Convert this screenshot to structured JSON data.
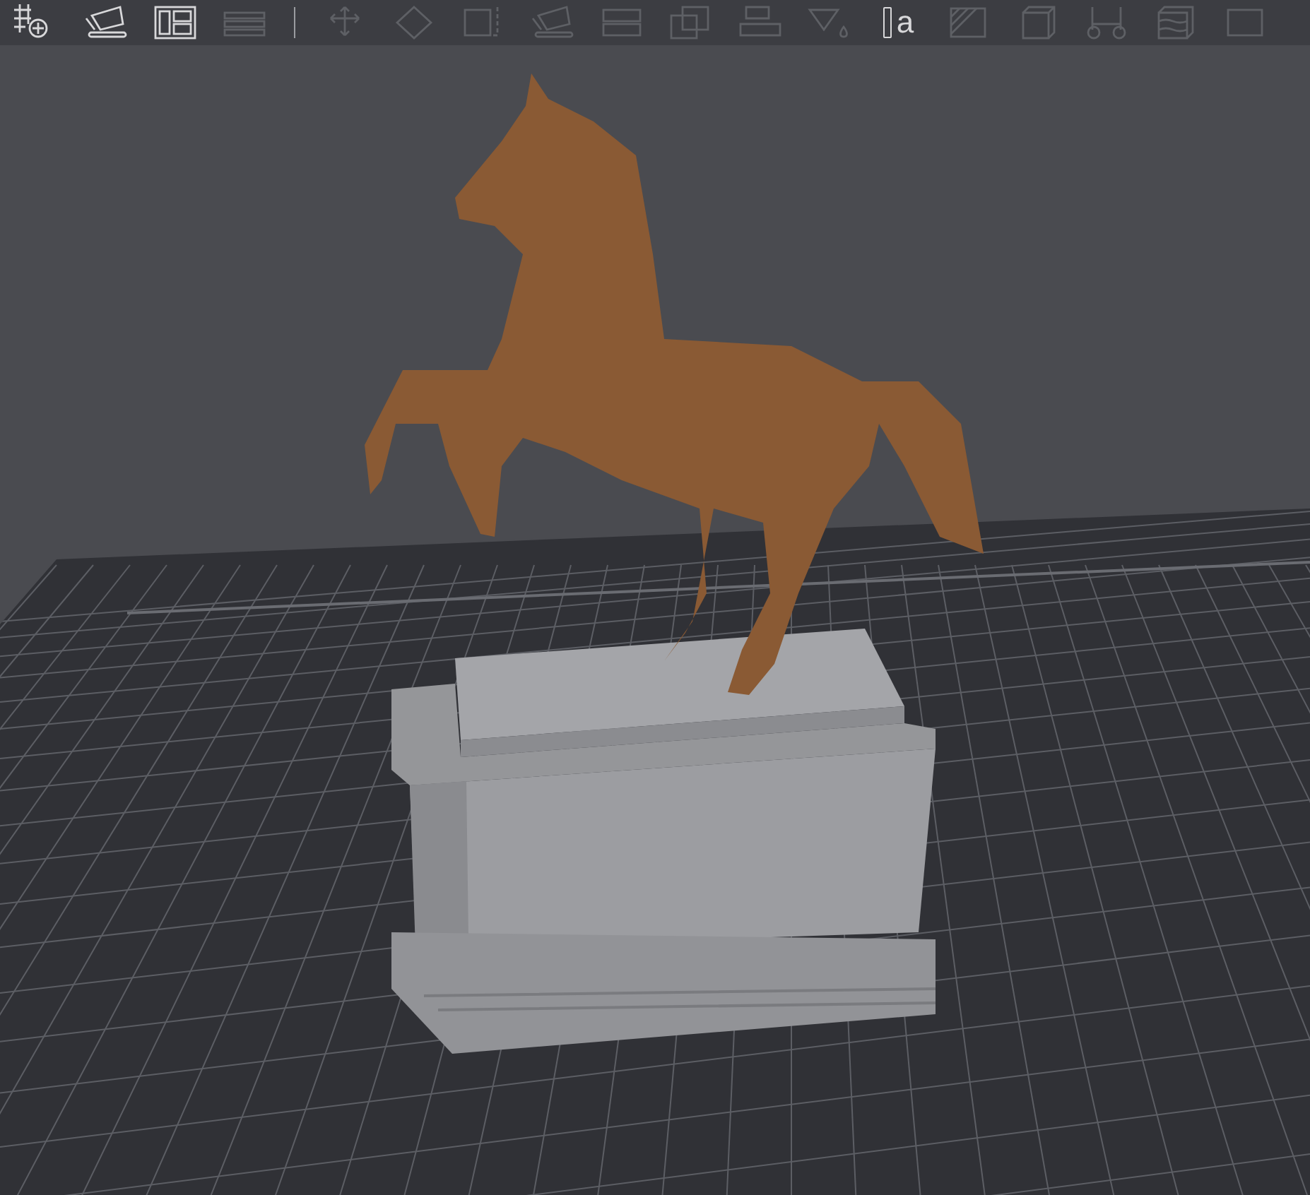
{
  "toolbar": {
    "items": [
      {
        "kind": "tool",
        "disabled": false
      },
      {
        "kind": "tool",
        "disabled": false
      },
      {
        "kind": "tool",
        "disabled": false
      },
      {
        "kind": "tool",
        "disabled": true
      },
      {
        "kind": "divider"
      },
      {
        "kind": "tool",
        "disabled": true
      },
      {
        "kind": "tool",
        "disabled": true
      },
      {
        "kind": "tool",
        "disabled": true
      },
      {
        "kind": "tool",
        "disabled": true
      },
      {
        "kind": "tool",
        "disabled": true
      },
      {
        "kind": "tool",
        "disabled": true
      },
      {
        "kind": "tool",
        "disabled": true
      },
      {
        "kind": "tool",
        "disabled": true
      },
      {
        "kind": "text",
        "glyph": "a",
        "disabled": false
      },
      {
        "kind": "tool",
        "disabled": true
      },
      {
        "kind": "tool",
        "disabled": true
      },
      {
        "kind": "tool",
        "disabled": true
      },
      {
        "kind": "tool",
        "disabled": true
      },
      {
        "kind": "tool",
        "disabled": true
      }
    ]
  }
}
